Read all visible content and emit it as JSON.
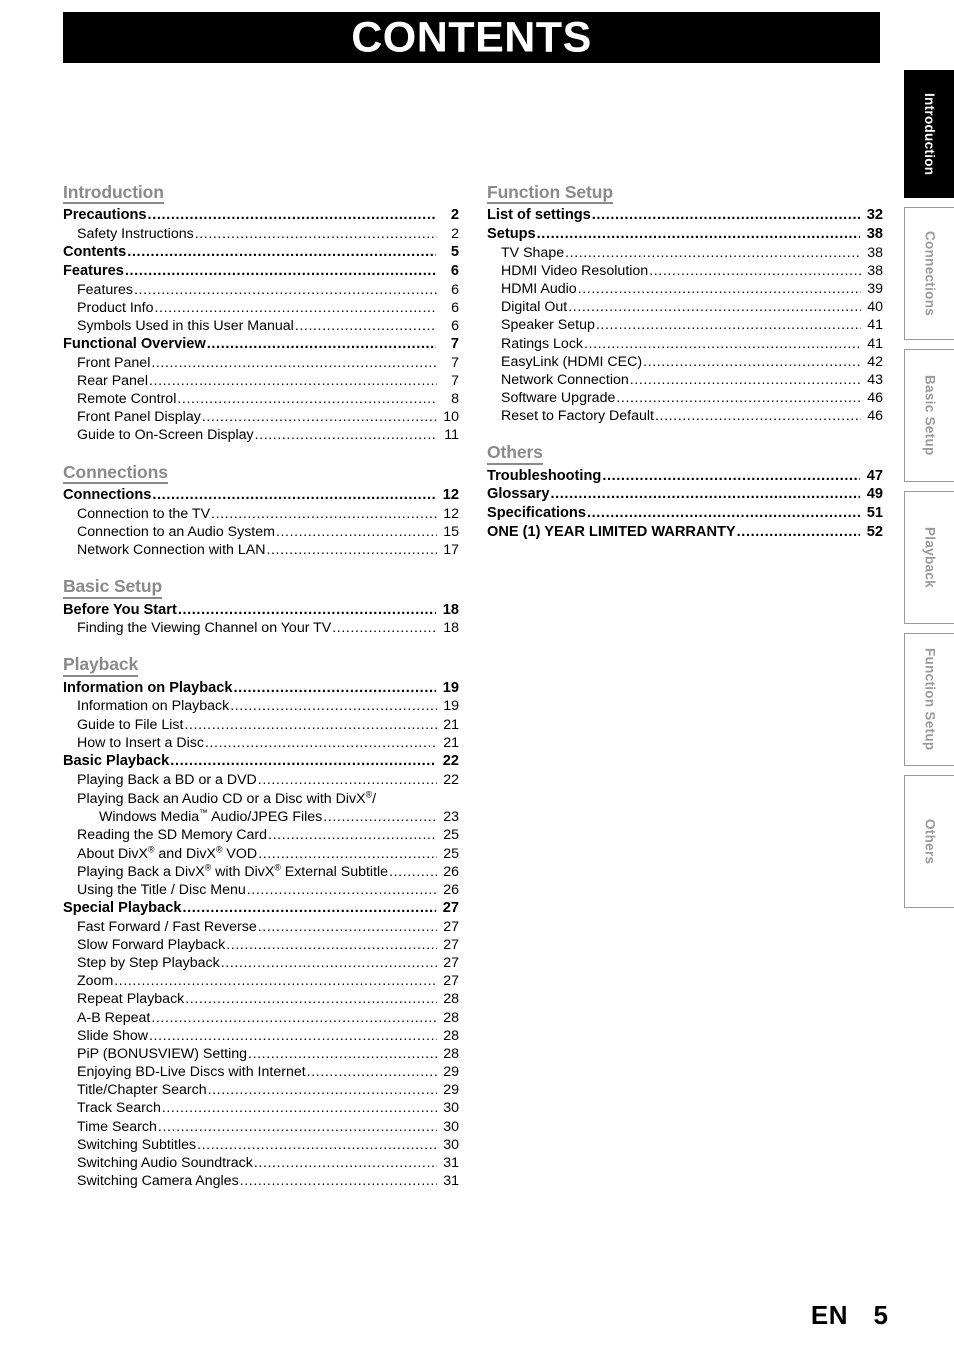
{
  "header": {
    "title": "CONTENTS"
  },
  "side_tabs": [
    {
      "label": "Introduction",
      "active": true
    },
    {
      "label": "Connections",
      "active": false
    },
    {
      "label": "Basic Setup",
      "active": false
    },
    {
      "label": "Playback",
      "active": false
    },
    {
      "label": "Function Setup",
      "active": false
    },
    {
      "label": "Others",
      "active": false
    }
  ],
  "toc": {
    "left_column": [
      {
        "heading": "Introduction",
        "entries": [
          {
            "level": 1,
            "label": "Precautions",
            "page": "2"
          },
          {
            "level": 2,
            "label": "Safety Instructions",
            "page": "2"
          },
          {
            "level": 1,
            "label": "Contents",
            "page": "5"
          },
          {
            "level": 1,
            "label": "Features",
            "page": "6"
          },
          {
            "level": 2,
            "label": "Features",
            "page": "6"
          },
          {
            "level": 2,
            "label": "Product Info",
            "page": "6"
          },
          {
            "level": 2,
            "label": "Symbols Used in this User Manual",
            "page": "6"
          },
          {
            "level": 1,
            "label": "Functional Overview",
            "page": "7"
          },
          {
            "level": 2,
            "label": "Front Panel",
            "page": "7"
          },
          {
            "level": 2,
            "label": "Rear Panel",
            "page": "7"
          },
          {
            "level": 2,
            "label": "Remote Control",
            "page": "8"
          },
          {
            "level": 2,
            "label": "Front Panel Display",
            "page": "10"
          },
          {
            "level": 2,
            "label": "Guide to On-Screen Display",
            "page": "11"
          }
        ]
      },
      {
        "heading": "Connections",
        "entries": [
          {
            "level": 1,
            "label": "Connections",
            "page": "12"
          },
          {
            "level": 2,
            "label": "Connection to the TV",
            "page": "12"
          },
          {
            "level": 2,
            "label": "Connection to an Audio System",
            "page": "15"
          },
          {
            "level": 2,
            "label": "Network Connection with LAN",
            "page": "17"
          }
        ]
      },
      {
        "heading": "Basic Setup",
        "entries": [
          {
            "level": 1,
            "label": "Before You Start",
            "page": "18"
          },
          {
            "level": 2,
            "label": "Finding the Viewing Channel on Your TV",
            "page": "18"
          }
        ]
      },
      {
        "heading": "Playback",
        "entries": [
          {
            "level": 1,
            "label": "Information on Playback",
            "page": "19"
          },
          {
            "level": 2,
            "label": "Information on Playback",
            "page": "19"
          },
          {
            "level": 2,
            "label": "Guide to File List",
            "page": "21"
          },
          {
            "level": 2,
            "label": "How to Insert a Disc",
            "page": "21"
          },
          {
            "level": 1,
            "label": "Basic Playback",
            "page": "22"
          },
          {
            "level": 2,
            "label": "Playing Back a BD or a DVD",
            "page": "22"
          },
          {
            "level": 2,
            "label": "Playing Back an Audio CD or a Disc with DivX®/",
            "page": "",
            "wrapped_head": true
          },
          {
            "level": 2,
            "label": "Windows Media™ Audio/JPEG Files",
            "page": "23",
            "continuation": true
          },
          {
            "level": 2,
            "label": "Reading the SD Memory Card",
            "page": "25"
          },
          {
            "level": 2,
            "label": "About DivX® and DivX® VOD",
            "page": "25"
          },
          {
            "level": 2,
            "label": "Playing Back a DivX® with DivX® External Subtitle",
            "page": "26"
          },
          {
            "level": 2,
            "label": "Using the Title / Disc Menu",
            "page": "26"
          },
          {
            "level": 1,
            "label": "Special Playback",
            "page": "27"
          },
          {
            "level": 2,
            "label": "Fast Forward / Fast Reverse",
            "page": "27"
          },
          {
            "level": 2,
            "label": "Slow Forward Playback",
            "page": "27"
          },
          {
            "level": 2,
            "label": "Step by Step Playback",
            "page": "27"
          },
          {
            "level": 2,
            "label": "Zoom",
            "page": "27"
          },
          {
            "level": 2,
            "label": "Repeat Playback",
            "page": "28"
          },
          {
            "level": 2,
            "label": "A-B Repeat",
            "page": "28"
          },
          {
            "level": 2,
            "label": "Slide Show",
            "page": "28"
          },
          {
            "level": 2,
            "label": "PiP (BONUSVIEW) Setting",
            "page": "28"
          },
          {
            "level": 2,
            "label": "Enjoying BD-Live Discs with Internet",
            "page": "29"
          },
          {
            "level": 2,
            "label": "Title/Chapter Search",
            "page": "29"
          },
          {
            "level": 2,
            "label": "Track Search",
            "page": "30"
          },
          {
            "level": 2,
            "label": "Time Search",
            "page": "30"
          },
          {
            "level": 2,
            "label": "Switching Subtitles",
            "page": "30"
          },
          {
            "level": 2,
            "label": "Switching Audio Soundtrack",
            "page": "31"
          },
          {
            "level": 2,
            "label": "Switching Camera Angles",
            "page": "31"
          }
        ]
      }
    ],
    "right_column": [
      {
        "heading": "Function Setup",
        "entries": [
          {
            "level": 1,
            "label": "List of settings",
            "page": "32"
          },
          {
            "level": 1,
            "label": "Setups",
            "page": "38"
          },
          {
            "level": 2,
            "label": "TV Shape",
            "page": "38"
          },
          {
            "level": 2,
            "label": "HDMI Video Resolution",
            "page": "38"
          },
          {
            "level": 2,
            "label": "HDMI Audio",
            "page": "39"
          },
          {
            "level": 2,
            "label": "Digital Out",
            "page": "40"
          },
          {
            "level": 2,
            "label": "Speaker Setup",
            "page": "41"
          },
          {
            "level": 2,
            "label": "Ratings Lock",
            "page": "41"
          },
          {
            "level": 2,
            "label": "EasyLink (HDMI CEC)",
            "page": "42"
          },
          {
            "level": 2,
            "label": "Network Connection",
            "page": "43"
          },
          {
            "level": 2,
            "label": "Software Upgrade",
            "page": "46"
          },
          {
            "level": 2,
            "label": "Reset to Factory Default",
            "page": "46"
          }
        ]
      },
      {
        "heading": "Others",
        "entries": [
          {
            "level": 1,
            "label": "Troubleshooting",
            "page": "47"
          },
          {
            "level": 1,
            "label": "Glossary",
            "page": "49"
          },
          {
            "level": 1,
            "label": "Specifications",
            "page": "51"
          },
          {
            "level": 1,
            "label": "ONE (1) YEAR LIMITED WARRANTY",
            "page": "52"
          }
        ]
      }
    ]
  },
  "footer": {
    "language": "EN",
    "page_number": "5"
  },
  "colors": {
    "banner_bg": "#000000",
    "banner_text": "#ffffff",
    "section_heading": "#8a8a8a",
    "tab_inactive_text": "#9a9a9a",
    "tab_active_bg": "#000000",
    "body_text": "#000000"
  }
}
